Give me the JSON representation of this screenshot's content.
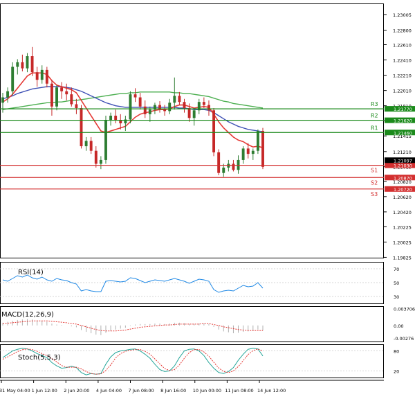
{
  "chart_data": [
    {
      "type": "candlestick",
      "panel": "price",
      "title": "",
      "y_ticks": [
        "1.23005",
        "1.22800",
        "1.22610",
        "1.22410",
        "1.22210",
        "1.22010",
        "1.21810",
        "1.21615",
        "1.21415",
        "1.21210",
        "1.21015",
        "1.20820",
        "1.20620",
        "1.20420",
        "1.20225",
        "1.20025",
        "1.19825"
      ],
      "ylim": [
        1.1982,
        1.2315
      ],
      "x_ticks": [
        "31 May 04:00",
        "1 Jun 12:00",
        "2 Jun 20:00",
        "4 Jun 04:00",
        "7 Jun 08:00",
        "8 Jun 16:00",
        "10 Jun 00:00",
        "11 Jun 08:00",
        "14 Jun 12:00"
      ],
      "colors": {
        "bull": "#2e7d32",
        "bear": "#c62828",
        "ma_fast": "#e53935",
        "ma_mid": "#3f51b5",
        "ma_slow": "#4caf50",
        "resistance": "#1b8a1b",
        "support": "#d32f2f"
      },
      "candles": [
        [
          1.2185,
          1.2198,
          1.2172,
          1.2192
        ],
        [
          1.2192,
          1.2205,
          1.2185,
          1.22
        ],
        [
          1.22,
          1.2238,
          1.2195,
          1.2232
        ],
        [
          1.2232,
          1.2242,
          1.2222,
          1.2238
        ],
        [
          1.2238,
          1.2248,
          1.2226,
          1.223
        ],
        [
          1.223,
          1.225,
          1.2225,
          1.2246
        ],
        [
          1.2246,
          1.2258,
          1.222,
          1.2225
        ],
        [
          1.2225,
          1.2232,
          1.2206,
          1.2215
        ],
        [
          1.2215,
          1.2234,
          1.221,
          1.2228
        ],
        [
          1.2228,
          1.2232,
          1.2205,
          1.221
        ],
        [
          1.221,
          1.2215,
          1.2168,
          1.218
        ],
        [
          1.218,
          1.2208,
          1.2175,
          1.2205
        ],
        [
          1.2205,
          1.2212,
          1.219,
          1.22
        ],
        [
          1.22,
          1.221,
          1.2188,
          1.2196
        ],
        [
          1.2196,
          1.2205,
          1.218,
          1.2183
        ],
        [
          1.2183,
          1.219,
          1.217,
          1.2178
        ],
        [
          1.2178,
          1.2182,
          1.2125,
          1.2128
        ],
        [
          1.2128,
          1.214,
          1.2122,
          1.2135
        ],
        [
          1.2135,
          1.214,
          1.2118,
          1.2122
        ],
        [
          1.2122,
          1.2128,
          1.21,
          1.2105
        ],
        [
          1.2105,
          1.2115,
          1.2098,
          1.211
        ],
        [
          1.211,
          1.2168,
          1.2105,
          1.2162
        ],
        [
          1.2162,
          1.2172,
          1.2155,
          1.2168
        ],
        [
          1.2168,
          1.2176,
          1.2158,
          1.2162
        ],
        [
          1.2162,
          1.217,
          1.215,
          1.2158
        ],
        [
          1.2158,
          1.2168,
          1.2148,
          1.2163
        ],
        [
          1.2163,
          1.22,
          1.2158,
          1.2196
        ],
        [
          1.2196,
          1.2204,
          1.2186,
          1.2192
        ],
        [
          1.2192,
          1.2198,
          1.2176,
          1.218
        ],
        [
          1.218,
          1.2188,
          1.2165,
          1.217
        ],
        [
          1.217,
          1.218,
          1.216,
          1.2176
        ],
        [
          1.2176,
          1.2185,
          1.217,
          1.2182
        ],
        [
          1.2182,
          1.2187,
          1.2172,
          1.2176
        ],
        [
          1.2176,
          1.2182,
          1.2168,
          1.2174
        ],
        [
          1.2174,
          1.219,
          1.217,
          1.2185
        ],
        [
          1.2185,
          1.2218,
          1.2176,
          1.2194
        ],
        [
          1.2194,
          1.2199,
          1.2182,
          1.2186
        ],
        [
          1.2186,
          1.219,
          1.2172,
          1.2178
        ],
        [
          1.2178,
          1.2184,
          1.216,
          1.2165
        ],
        [
          1.2165,
          1.2178,
          1.2155,
          1.2175
        ],
        [
          1.2175,
          1.219,
          1.217,
          1.2186
        ],
        [
          1.2186,
          1.2192,
          1.2178,
          1.2182
        ],
        [
          1.2182,
          1.2188,
          1.2168,
          1.2175
        ],
        [
          1.2175,
          1.2178,
          1.2115,
          1.212
        ],
        [
          1.212,
          1.2124,
          1.209,
          1.2093
        ],
        [
          1.2093,
          1.2105,
          1.2088,
          1.21
        ],
        [
          1.21,
          1.211,
          1.2095,
          1.2105
        ],
        [
          1.2105,
          1.211,
          1.2095,
          1.2097
        ],
        [
          1.2097,
          1.2116,
          1.2092,
          1.211
        ],
        [
          1.211,
          1.2128,
          1.2105,
          1.2125
        ],
        [
          1.2125,
          1.2132,
          1.2112,
          1.2118
        ],
        [
          1.2118,
          1.2125,
          1.211,
          1.2122
        ],
        [
          1.2122,
          1.215,
          1.2118,
          1.2148
        ],
        [
          1.2148,
          1.2152,
          1.2098,
          1.2101
        ]
      ],
      "ma_fast": [
        1.2186,
        1.219,
        1.2196,
        1.2204,
        1.2212,
        1.222,
        1.2224,
        1.2224,
        1.2224,
        1.2222,
        1.2214,
        1.2208,
        1.2206,
        1.2204,
        1.2202,
        1.2198,
        1.2188,
        1.2178,
        1.2168,
        1.2158,
        1.2148,
        1.2146,
        1.2148,
        1.215,
        1.2152,
        1.2154,
        1.216,
        1.2166,
        1.217,
        1.2172,
        1.2173,
        1.2175,
        1.2176,
        1.2176,
        1.2177,
        1.218,
        1.2182,
        1.2182,
        1.218,
        1.2178,
        1.2179,
        1.218,
        1.2179,
        1.217,
        1.216,
        1.2152,
        1.2146,
        1.214,
        1.2136,
        1.2134,
        1.213,
        1.2127,
        1.2128,
        1.2126
      ],
      "ma_mid": [
        1.219,
        1.2192,
        1.2194,
        1.2197,
        1.2199,
        1.2201,
        1.2203,
        1.2204,
        1.2205,
        1.2206,
        1.2206,
        1.2206,
        1.2206,
        1.2205,
        1.2204,
        1.2202,
        1.22,
        1.2197,
        1.2194,
        1.2191,
        1.2188,
        1.2185,
        1.2183,
        1.2181,
        1.218,
        1.2179,
        1.2179,
        1.2179,
        1.2179,
        1.2179,
        1.2179,
        1.2179,
        1.2179,
        1.2179,
        1.2179,
        1.2179,
        1.2178,
        1.2178,
        1.2177,
        1.2176,
        1.2176,
        1.2176,
        1.2175,
        1.2172,
        1.2168,
        1.2164,
        1.216,
        1.2157,
        1.2154,
        1.2152,
        1.215,
        1.2149,
        1.2148,
        1.2147
      ],
      "ma_slow": [
        1.2176,
        1.2177,
        1.2178,
        1.2179,
        1.218,
        1.2181,
        1.2182,
        1.2183,
        1.2184,
        1.2185,
        1.2185,
        1.2186,
        1.2186,
        1.2187,
        1.2188,
        1.2188,
        1.2189,
        1.219,
        1.2191,
        1.2192,
        1.2193,
        1.2194,
        1.2195,
        1.2196,
        1.2197,
        1.2197,
        1.2198,
        1.2198,
        1.2199,
        1.2199,
        1.2199,
        1.2199,
        1.2199,
        1.2199,
        1.2199,
        1.2198,
        1.2198,
        1.2197,
        1.2197,
        1.2196,
        1.2195,
        1.2194,
        1.2193,
        1.2191,
        1.2189,
        1.2187,
        1.2186,
        1.2184,
        1.2183,
        1.2182,
        1.2181,
        1.218,
        1.2179,
        1.2178
      ],
      "levels": [
        {
          "name": "R3",
          "value": 1.2177,
          "label": "1.21770",
          "kind": "resistance"
        },
        {
          "name": "R2",
          "value": 1.2162,
          "label": "1.21620",
          "kind": "resistance"
        },
        {
          "name": "R1",
          "value": 1.2146,
          "label": "1.21460",
          "kind": "resistance"
        },
        {
          "name": "S1",
          "value": 1.2103,
          "label": "1.21030",
          "kind": "support"
        },
        {
          "name": "S2",
          "value": 1.2087,
          "label": "1.20870",
          "kind": "support"
        },
        {
          "name": "S3",
          "value": 1.2072,
          "label": "1.20720",
          "kind": "support"
        }
      ],
      "current_price": {
        "value": 1.21097,
        "label": "1.21097"
      }
    },
    {
      "type": "line",
      "panel": "rsi",
      "series_label": "RSI(14)",
      "y_ticks": [
        "70",
        "50",
        "30"
      ],
      "ylim": [
        20,
        80
      ],
      "color": "#1e88e5",
      "values": [
        54,
        52,
        56,
        60,
        58,
        61,
        57,
        55,
        58,
        54,
        52,
        56,
        54,
        53,
        50,
        48,
        38,
        40,
        38,
        37,
        37,
        52,
        53,
        52,
        51,
        52,
        57,
        56,
        53,
        50,
        52,
        54,
        53,
        52,
        54,
        56,
        54,
        52,
        49,
        52,
        55,
        54,
        52,
        40,
        36,
        38,
        39,
        38,
        42,
        46,
        44,
        45,
        50,
        42
      ]
    },
    {
      "type": "bar",
      "panel": "macd",
      "series_label": "MACD(12,26,9)",
      "y_ticks": [
        "0.003706",
        "0.00",
        "-0.00276"
      ],
      "ylim": [
        -0.0035,
        0.0042
      ],
      "colors": {
        "histogram": "#b0b0b0",
        "signal": "#e53935"
      },
      "histogram": [
        0.0006,
        0.0008,
        0.001,
        0.0012,
        0.0013,
        0.0014,
        0.0013,
        0.0011,
        0.001,
        0.0008,
        0.0004,
        0.0002,
        0.0001,
        0.0,
        -0.0002,
        -0.0004,
        -0.001,
        -0.0014,
        -0.0017,
        -0.002,
        -0.0021,
        -0.0016,
        -0.0012,
        -0.0009,
        -0.0007,
        -0.0005,
        -0.0001,
        0.0002,
        0.0003,
        0.0003,
        0.0003,
        0.0004,
        0.0004,
        0.0003,
        0.0004,
        0.0006,
        0.0006,
        0.0005,
        0.0003,
        0.0003,
        0.0004,
        0.0004,
        0.0003,
        -0.0003,
        -0.0009,
        -0.0013,
        -0.0015,
        -0.0017,
        -0.0016,
        -0.0014,
        -0.0013,
        -0.0012,
        -0.0009,
        -0.0011
      ],
      "signal": [
        0.0004,
        0.0005,
        0.0006,
        0.0007,
        0.0008,
        0.0009,
        0.001,
        0.001,
        0.001,
        0.001,
        0.0009,
        0.0008,
        0.0007,
        0.0006,
        0.0004,
        0.0003,
        0.0,
        -0.0003,
        -0.0006,
        -0.0009,
        -0.0011,
        -0.0012,
        -0.0012,
        -0.0012,
        -0.0011,
        -0.001,
        -0.0008,
        -0.0006,
        -0.0004,
        -0.0003,
        -0.0002,
        -0.0001,
        0.0,
        0.0001,
        0.0001,
        0.0002,
        0.0003,
        0.0003,
        0.0003,
        0.0003,
        0.0003,
        0.0004,
        0.0004,
        0.0002,
        0.0,
        -0.0003,
        -0.0005,
        -0.0007,
        -0.0009,
        -0.001,
        -0.0011,
        -0.0011,
        -0.0011,
        -0.0011
      ]
    },
    {
      "type": "line",
      "panel": "stoch",
      "series_label": "Stoch(5,5,3)",
      "y_ticks": [
        "80",
        "20"
      ],
      "ylim": [
        0,
        100
      ],
      "colors": {
        "k": "#26a69a",
        "d": "#e53935"
      },
      "k_values": [
        60,
        70,
        80,
        85,
        88,
        86,
        80,
        72,
        66,
        60,
        45,
        35,
        28,
        30,
        34,
        30,
        15,
        8,
        12,
        10,
        12,
        40,
        62,
        75,
        80,
        82,
        85,
        86,
        80,
        70,
        58,
        40,
        24,
        18,
        20,
        35,
        60,
        80,
        85,
        86,
        80,
        66,
        45,
        28,
        15,
        12,
        18,
        30,
        52,
        70,
        85,
        88,
        86,
        65
      ],
      "d_values": [
        55,
        62,
        70,
        78,
        84,
        86,
        84,
        79,
        72,
        66,
        57,
        47,
        36,
        31,
        31,
        31,
        26,
        18,
        12,
        10,
        11,
        21,
        38,
        59,
        72,
        79,
        82,
        84,
        84,
        79,
        70,
        56,
        41,
        27,
        21,
        24,
        38,
        58,
        75,
        84,
        84,
        77,
        64,
        46,
        29,
        18,
        15,
        20,
        33,
        51,
        69,
        81,
        86,
        80
      ]
    }
  ]
}
